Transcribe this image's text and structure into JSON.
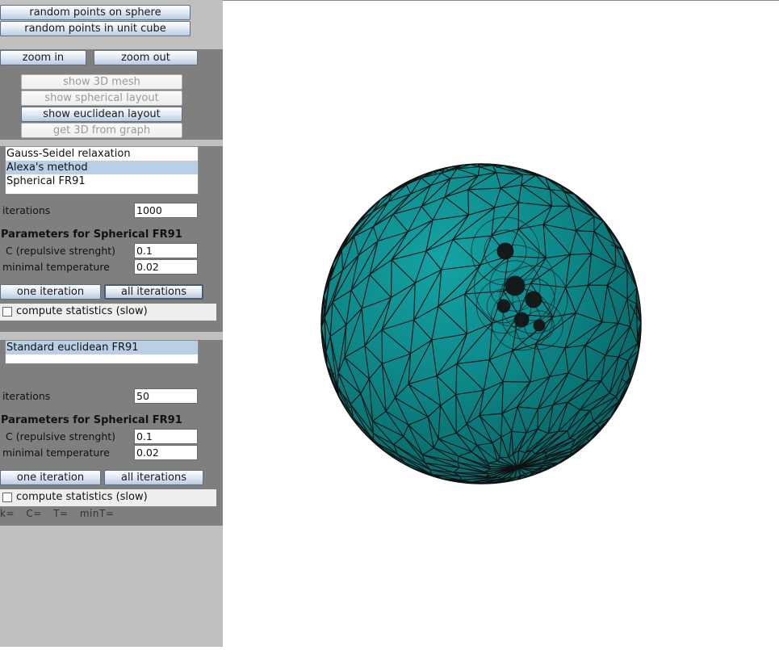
{
  "top_buttons": {
    "random_sphere": "random points on sphere",
    "random_cube": "random points in unit cube"
  },
  "view_buttons": {
    "zoom_in": "zoom in",
    "zoom_out": "zoom out",
    "show_mesh": "show 3D mesh",
    "show_spherical": "show spherical layout",
    "show_euclidean": "show euclidean layout",
    "get_3d": "get 3D from graph"
  },
  "spherical": {
    "methods": [
      "Gauss-Seidel relaxation",
      "Alexa's method",
      "Spherical FR91"
    ],
    "selected_method": "Alexa's method",
    "iterations_label": "iterations",
    "iterations_value": "1000",
    "params_title": "Parameters for Spherical FR91",
    "c_label": "C (repulsive strenght)",
    "c_value": "0.1",
    "min_temp_label": "minimal temperature",
    "min_temp_value": "0.02",
    "one_iteration": "one iteration",
    "all_iterations": "all iterations",
    "compute_stats": "compute statistics (slow)",
    "compute_stats_checked": false
  },
  "euclidean": {
    "methods": [
      "Standard euclidean FR91"
    ],
    "selected_method": "Standard euclidean FR91",
    "iterations_label": "iterations",
    "iterations_value": "50",
    "params_title": "Parameters for Spherical FR91",
    "c_label": "C (repulsive strenght)",
    "c_value": "0.1",
    "min_temp_label": "minimal temperature",
    "min_temp_value": "0.02",
    "one_iteration": "one iteration",
    "all_iterations": "all iterations",
    "compute_stats": "compute statistics (slow)",
    "compute_stats_checked": false
  },
  "status": {
    "k": "k=",
    "c": "C=",
    "t": "T=",
    "min_t": "minT="
  },
  "canvas": {
    "sphere_color": "#0e8a8c",
    "edge_color": "#101010"
  }
}
